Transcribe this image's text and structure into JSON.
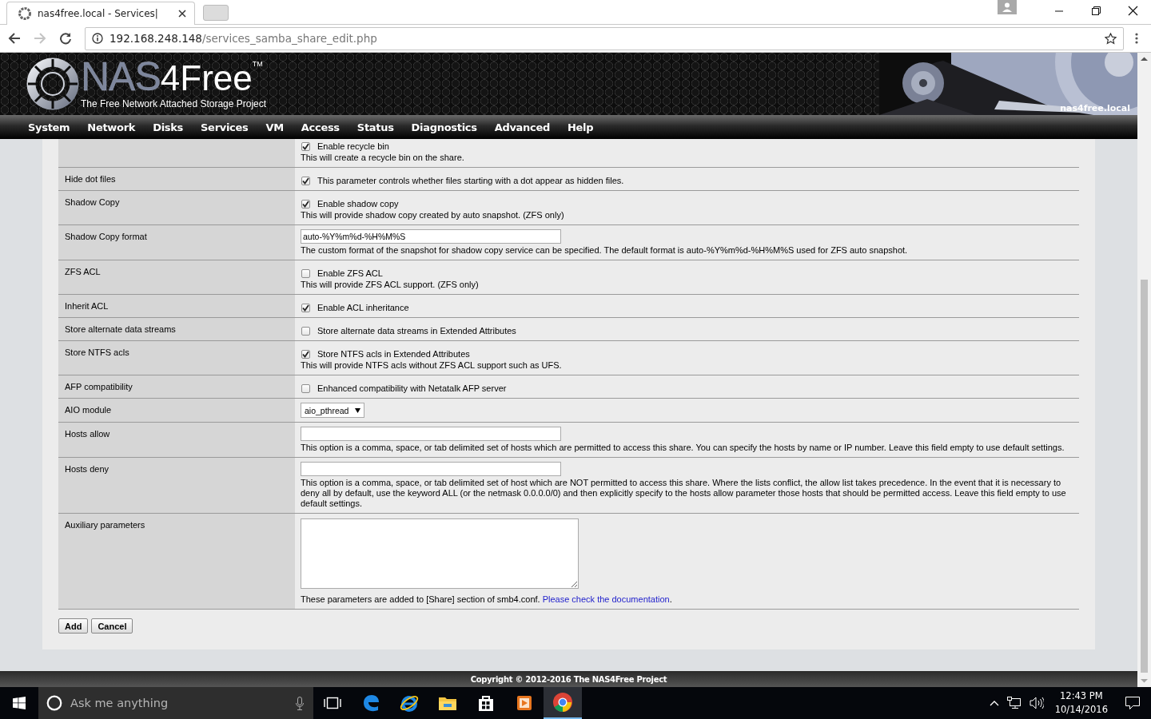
{
  "browser": {
    "tab_title": "nas4free.local - Services|",
    "url_host": "192.168.248.148",
    "url_path": "/services_samba_share_edit.php"
  },
  "header": {
    "logo_light": "NAS",
    "logo_bold": "4Free",
    "trademark": "TM",
    "tagline": "The Free Network Attached Storage Project",
    "hostname": "nas4free.local"
  },
  "nav": [
    "System",
    "Network",
    "Disks",
    "Services",
    "VM",
    "Access",
    "Status",
    "Diagnostics",
    "Advanced",
    "Help"
  ],
  "rows": [
    {
      "kind": "checkbox",
      "checked": true,
      "option": "Enable recycle bin",
      "description": "This will create a recycle bin on the share."
    },
    {
      "kind": "checkbox",
      "label": "Hide dot files",
      "checked": true,
      "option": "This parameter controls whether files starting with a dot appear as hidden files."
    },
    {
      "kind": "checkbox",
      "label": "Shadow Copy",
      "checked": true,
      "option": "Enable shadow copy",
      "description": "This will provide shadow copy created by auto snapshot. (ZFS only)"
    },
    {
      "kind": "text",
      "label": "Shadow Copy format",
      "value": "auto-%Y%m%d-%H%M%S",
      "description": "The custom format of the snapshot for shadow copy service can be specified. The default format is auto-%Y%m%d-%H%M%S used for ZFS auto snapshot."
    },
    {
      "kind": "checkbox",
      "label": "ZFS ACL",
      "checked": false,
      "option": "Enable ZFS ACL",
      "description": "This will provide ZFS ACL support. (ZFS only)"
    },
    {
      "kind": "checkbox",
      "label": "Inherit ACL",
      "checked": true,
      "option": "Enable ACL inheritance"
    },
    {
      "kind": "checkbox",
      "label": "Store alternate data streams",
      "checked": false,
      "option": "Store alternate data streams in Extended Attributes"
    },
    {
      "kind": "checkbox",
      "label": "Store NTFS acls",
      "checked": true,
      "option": "Store NTFS acls in Extended Attributes",
      "description": "This will provide NTFS acls without ZFS ACL support such as UFS."
    },
    {
      "kind": "checkbox",
      "label": "AFP compatibility",
      "checked": false,
      "option": "Enhanced compatibility with Netatalk AFP server"
    },
    {
      "kind": "select",
      "label": "AIO module",
      "value": "aio_pthread"
    },
    {
      "kind": "text",
      "label": "Hosts allow",
      "description": "This option is a comma, space, or tab delimited set of hosts which are permitted to access this share. You can specify the hosts by name or IP number. Leave this field empty to use default settings."
    },
    {
      "kind": "text",
      "label": "Hosts deny",
      "description": "This option is a comma, space, or tab delimited set of host which are NOT permitted to access this share. Where the lists conflict, the allow list takes precedence. In the event that it is necessary to deny all by default, use the keyword ALL (or the netmask 0.0.0.0/0) and then explicitly specify to the hosts allow parameter those hosts that should be permitted access. Leave this field empty to use default settings."
    },
    {
      "kind": "textarea",
      "label": "Auxiliary parameters",
      "description": "These parameters are added to [Share] section of smb4.conf. ",
      "link": "Please check the documentation",
      "suffix": "."
    }
  ],
  "buttons": [
    "Add",
    "Cancel"
  ],
  "footer": "Copyright © 2012-2016 The NAS4Free Project",
  "taskbar": {
    "search_placeholder": "Ask me anything",
    "time": "12:43 PM",
    "date": "10/14/2016"
  }
}
